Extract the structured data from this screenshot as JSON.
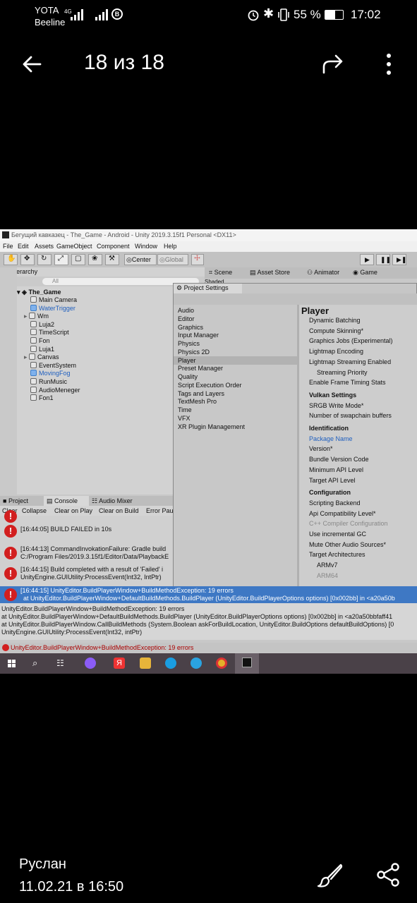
{
  "status_bar": {
    "carrier1": "YOTA",
    "carrier2": "Beeline",
    "net1": "4G",
    "battery_percent": "55 %",
    "time": "17:02"
  },
  "top_bar": {
    "title": "18 из 18"
  },
  "unity": {
    "window_title": "Бегущий кавказец - The_Game - Android - Unity 2019.3.15f1 Personal <DX11>",
    "menu": [
      "File",
      "Edit",
      "Assets",
      "GameObject",
      "Component",
      "Window",
      "Help"
    ],
    "toolbar": {
      "center_label": "Center",
      "global_label": "Global"
    },
    "scene_tabs": {
      "scene": "Scene",
      "asset_store": "Asset Store",
      "animator": "Animator",
      "game": "Game",
      "shaded": "Shaded"
    },
    "hierarchy": {
      "tab": "Hierarchy",
      "search_placeholder": "All",
      "root": "The_Game",
      "items": [
        {
          "label": "Main Camera",
          "blue": false,
          "arrow": false
        },
        {
          "label": "WaterTrigger",
          "blue": true,
          "arrow": false
        },
        {
          "label": "Wm",
          "blue": false,
          "arrow": true
        },
        {
          "label": "Luja2",
          "blue": false,
          "arrow": false
        },
        {
          "label": "TimeScript",
          "blue": false,
          "arrow": false
        },
        {
          "label": "Fon",
          "blue": false,
          "arrow": false
        },
        {
          "label": "Luja1",
          "blue": false,
          "arrow": false
        },
        {
          "label": "Canvas",
          "blue": false,
          "arrow": true
        },
        {
          "label": "EventSystem",
          "blue": false,
          "arrow": false
        },
        {
          "label": "MovingFog",
          "blue": true,
          "arrow": false
        },
        {
          "label": "RunMusic",
          "blue": false,
          "arrow": false
        },
        {
          "label": "AudioMeneger",
          "blue": false,
          "arrow": false
        },
        {
          "label": "Fon1",
          "blue": false,
          "arrow": false
        }
      ]
    },
    "project_settings": {
      "title": "Project Settings",
      "categories": [
        "Audio",
        "Editor",
        "Graphics",
        "Input Manager",
        "Physics",
        "Physics 2D",
        "Player",
        "Preset Manager",
        "Quality",
        "Script Execution Order",
        "Tags and Layers",
        "TextMesh Pro",
        "Time",
        "VFX",
        "XR Plugin Management"
      ],
      "selected_index": 6,
      "player_heading": "Player",
      "player_items": [
        {
          "label": "Dynamic Batching",
          "style": "normal"
        },
        {
          "label": "Compute Skinning*",
          "style": "normal"
        },
        {
          "label": "Graphics Jobs (Experimental)",
          "style": "normal"
        },
        {
          "label": "Lightmap Encoding",
          "style": "normal"
        },
        {
          "label": "Lightmap Streaming Enabled",
          "style": "normal"
        },
        {
          "label": "Streaming Priority",
          "style": "indent"
        },
        {
          "label": "Enable Frame Timing Stats",
          "style": "normal"
        },
        {
          "label": "Vulkan Settings",
          "style": "head"
        },
        {
          "label": "SRGB Write Mode*",
          "style": "normal"
        },
        {
          "label": "Number of swapchain buffers",
          "style": "normal"
        },
        {
          "label": "Identification",
          "style": "head"
        },
        {
          "label": "Package Name",
          "style": "blue"
        },
        {
          "label": "Version*",
          "style": "normal"
        },
        {
          "label": "Bundle Version Code",
          "style": "normal"
        },
        {
          "label": "Minimum API Level",
          "style": "normal"
        },
        {
          "label": "Target API Level",
          "style": "normal"
        },
        {
          "label": "Configuration",
          "style": "head"
        },
        {
          "label": "Scripting Backend",
          "style": "normal"
        },
        {
          "label": "Api Compatibility Level*",
          "style": "normal"
        },
        {
          "label": "C++ Compiler Configuration",
          "style": "gray"
        },
        {
          "label": "Use incremental GC",
          "style": "normal"
        },
        {
          "label": "Mute Other Audio Sources*",
          "style": "normal"
        },
        {
          "label": "Target Architectures",
          "style": "normal"
        },
        {
          "label": "ARMv7",
          "style": "indent"
        },
        {
          "label": "ARM64",
          "style": "indentgray"
        }
      ]
    },
    "console": {
      "tabs": {
        "project": "Project",
        "console": "Console",
        "audio_mixer": "Audio Mixer"
      },
      "buttons": [
        "Clear",
        "Collapse",
        "Clear on Play",
        "Clear on Build",
        "Error Pau"
      ],
      "entries": [
        {
          "line1": "[16:44:05] BUILD FAILED in 10s",
          "line2": ""
        },
        {
          "line1": "[16:44:13] CommandInvokationFailure: Gradle build",
          "line2": "C:/Program Files/2019.3.15f1/Editor/Data/PlaybackE"
        },
        {
          "line1": "[16:44:15] Build completed with a result of 'Failed' i",
          "line2": "UnityEngine.GUIUtility:ProcessEvent(Int32, IntPtr)"
        }
      ],
      "selected": {
        "line1": "[16:44:15] UnityEditor.BuildPlayerWindow+BuildMethodException: 19 errors",
        "line2": "at UnityEditor.BuildPlayerWindow+DefaultBuildMethods.BuildPlayer (UnityEditor.BuildPlayerOptions options) [0x002bb] in <a20a50b"
      },
      "detail": [
        "UnityEditor.BuildPlayerWindow+BuildMethodException: 19 errors",
        "  at UnityEditor.BuildPlayerWindow+DefaultBuildMethods.BuildPlayer (UnityEditor.BuildPlayerOptions options) [0x002bb] in <a20a50bbfaff41",
        "  at UnityEditor.BuildPlayerWindow.CallBuildMethods (System.Boolean askForBuildLocation, UnityEditor.BuildOptions defaultBuildOptions) [0",
        "UnityEngine.GUIUtility:ProcessEvent(Int32, intPtr)"
      ],
      "status_line": "UnityEditor.BuildPlayerWindow+BuildMethodException: 19 errors"
    }
  },
  "bottom": {
    "sender": "Руслан",
    "datetime": "11.02.21 в 16:50"
  }
}
